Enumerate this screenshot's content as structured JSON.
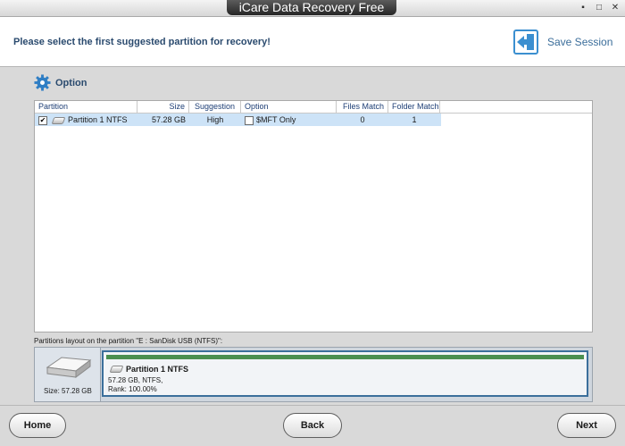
{
  "window": {
    "title": "iCare Data Recovery Free",
    "controls": [
      "minimize-icon",
      "maximize-icon",
      "close-icon"
    ]
  },
  "header": {
    "prompt": "Please select the first suggested partition for recovery!",
    "save_session_label": "Save Session",
    "save_session_icon": "save-session-icon"
  },
  "option": {
    "label": "Option",
    "icon": "gear-icon"
  },
  "table": {
    "columns": [
      "Partition",
      "Size",
      "Suggestion",
      "Option",
      "Files Match",
      "Folder Match"
    ],
    "rows": [
      {
        "checked": true,
        "partition": "Partition 1 NTFS",
        "size": "57.28 GB",
        "suggestion": "High",
        "option_checked": false,
        "option": "$MFT Only",
        "files_match": "0",
        "folder_match": "1"
      }
    ]
  },
  "layout": {
    "label": "Partitions layout on the partition \"E : SanDisk USB  (NTFS)\":",
    "disk_size": "Size: 57.28 GB",
    "partition_name": "Partition 1 NTFS",
    "partition_details": "57.28 GB, NTFS,",
    "partition_rank": "Rank: 100.00%"
  },
  "footer": {
    "home_label": "Home",
    "back_label": "Back",
    "next_label": "Next"
  },
  "colors": {
    "accent": "#3b6f9b",
    "row_selected": "#cde3f7",
    "partition_bar": "#4b8f50",
    "title_text": "#2a4a6e"
  }
}
